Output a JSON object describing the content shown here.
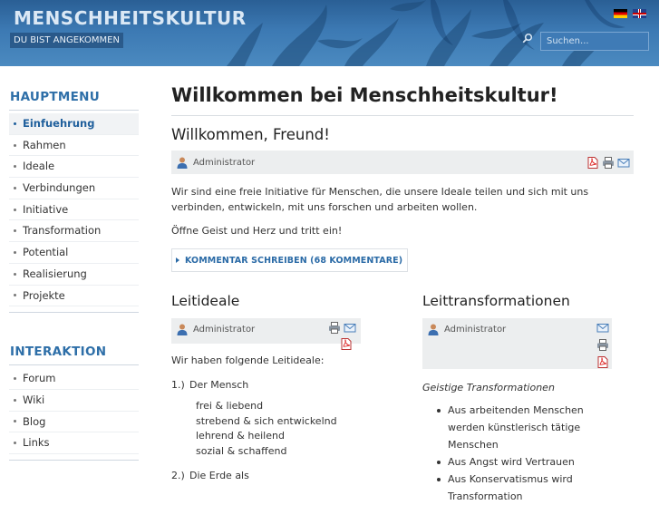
{
  "header": {
    "site_title": "MENSCHHEITSKULTUR",
    "tagline": "DU BIST ANGEKOMMEN",
    "search_placeholder": "Suchen...",
    "flags": [
      "german-flag-icon",
      "english-flag-icon"
    ]
  },
  "sidebar": {
    "main_menu_title": "HAUPTMENU",
    "main_items": [
      {
        "label": "Einfuehrung",
        "active": true
      },
      {
        "label": "Rahmen"
      },
      {
        "label": "Ideale"
      },
      {
        "label": "Verbindungen"
      },
      {
        "label": "Initiative"
      },
      {
        "label": "Transformation"
      },
      {
        "label": "Potential"
      },
      {
        "label": "Realisierung"
      },
      {
        "label": "Projekte"
      }
    ],
    "interaction_title": "INTERAKTION",
    "interaction_items": [
      {
        "label": "Forum"
      },
      {
        "label": "Wiki"
      },
      {
        "label": "Blog"
      },
      {
        "label": "Links"
      }
    ]
  },
  "main": {
    "page_title": "Willkommen bei Menschheitskultur!",
    "article": {
      "title": "Willkommen, Freund!",
      "author": "Administrator",
      "paragraph1": "Wir sind eine freie Initiative für Menschen, die unsere Ideale teilen und sich mit uns verbinden, entwickeln, mit uns forschen und arbeiten wollen.",
      "paragraph2": "Öffne Geist und Herz und tritt ein!",
      "comment_link": "KOMMENTAR SCHREIBEN (68 KOMMENTARE)"
    },
    "leitideale": {
      "title": "Leitideale",
      "author": "Administrator",
      "intro": "Wir haben folgende Leitideale:",
      "item1_num": "1.)",
      "item1_label": "Der Mensch",
      "item1_sub": [
        "frei & liebend",
        "strebend & sich entwickelnd",
        "lehrend & heilend",
        "sozial & schaffend"
      ],
      "item2_num": "2.)",
      "item2_label": "Die Erde als"
    },
    "leittransformationen": {
      "title": "Leittransformationen",
      "author": "Administrator",
      "subtitle": "Geistige Transformationen",
      "bullets": [
        "Aus arbeitenden Menschen werden künstlerisch tätige Menschen",
        "Aus Angst wird Vertrauen",
        "Aus Konservatismus wird Transformation"
      ]
    }
  },
  "colors": {
    "accent": "#2e6fa8",
    "header_bg": "#3c79b3",
    "metabar_bg": "#eceeef"
  }
}
